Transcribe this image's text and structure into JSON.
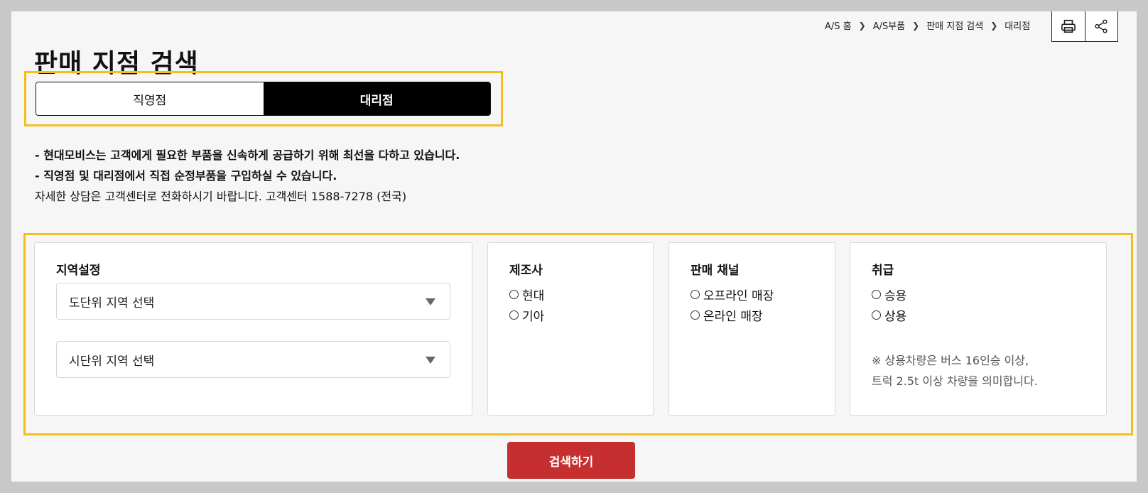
{
  "breadcrumb": [
    "A/S 홈",
    "A/S부품",
    "판매 지점 검색",
    "대리점"
  ],
  "toolbar": {
    "print_icon": "printer-icon",
    "share_icon": "share-icon"
  },
  "title": "판매 지점 검색",
  "tabs": [
    {
      "label": "직영점",
      "active": false
    },
    {
      "label": "대리점",
      "active": true
    }
  ],
  "notes": {
    "line1": "- 현대모비스는 고객에게 필요한 부품을 신속하게 공급하기 위해 최선을 다하고 있습니다.",
    "line2": "- 직영점 및 대리점에서 직접 순정부품을 구입하실 수 있습니다.",
    "line3": "자세한 상담은 고객센터로 전화하시기 바랍니다. 고객센터 1588-7278 (전국)"
  },
  "region": {
    "title": "지역설정",
    "province_select": "도단위 지역 선택",
    "city_select": "시단위 지역 선택"
  },
  "manufacturer": {
    "title": "제조사",
    "options": [
      "현대",
      "기아"
    ]
  },
  "channel": {
    "title": "판매 채널",
    "options": [
      "오프라인 매장",
      "온라인 매장"
    ]
  },
  "handling": {
    "title": "취급",
    "options": [
      "승용",
      "상용"
    ],
    "note_line1": "※ 상용차량은 버스 16인승 이상,",
    "note_line2": "트럭 2.5t 이상 차량을 의미합니다."
  },
  "search_button": "검색하기",
  "colors": {
    "accent_frame": "#f5be1f",
    "search_button": "#c62f2f",
    "active_tab": "#000000"
  }
}
